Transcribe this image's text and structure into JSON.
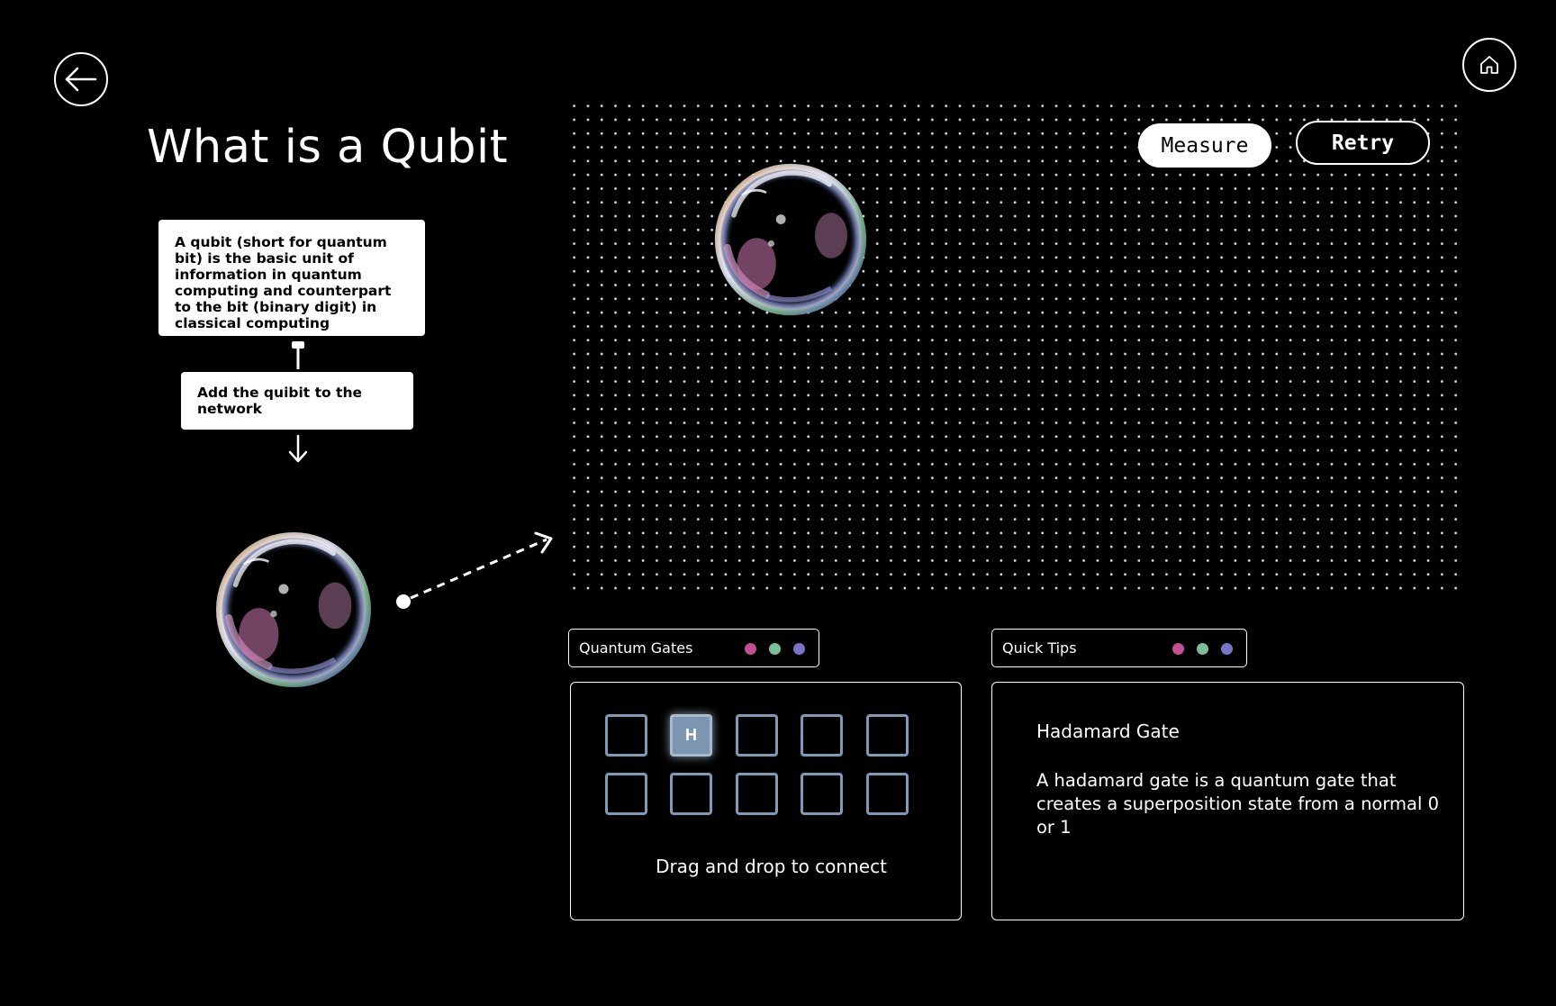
{
  "header": {
    "title": "What is a Qubit",
    "back_icon": "arrow-left-icon",
    "home_icon": "home-icon"
  },
  "definition": {
    "text": "A qubit (short for quantum bit) is the basic unit of information in quantum computing and counterpart to the bit (binary digit) in classical computing"
  },
  "instruction": {
    "text": "Add the quibit to the network"
  },
  "network": {
    "measure_label": "Measure",
    "retry_label": "Retry"
  },
  "gates_panel": {
    "tab_label": "Quantum Gates",
    "slots": [
      "",
      "H",
      "",
      "",
      "",
      "",
      "",
      "",
      "",
      ""
    ],
    "hint": "Drag and drop to connect"
  },
  "tips_panel": {
    "tab_label": "Quick Tips",
    "title": "Hadamard Gate",
    "body": "A hadamard gate is a quantum gate that creates a superposition state from a normal 0 or 1"
  },
  "colors": {
    "background": "#000000",
    "dot_pink": "#c2508f",
    "dot_green": "#7bbf98",
    "dot_purple": "#7a74c6",
    "gate_border": "#7f9bb8",
    "gate_active": "#7d96b0"
  }
}
